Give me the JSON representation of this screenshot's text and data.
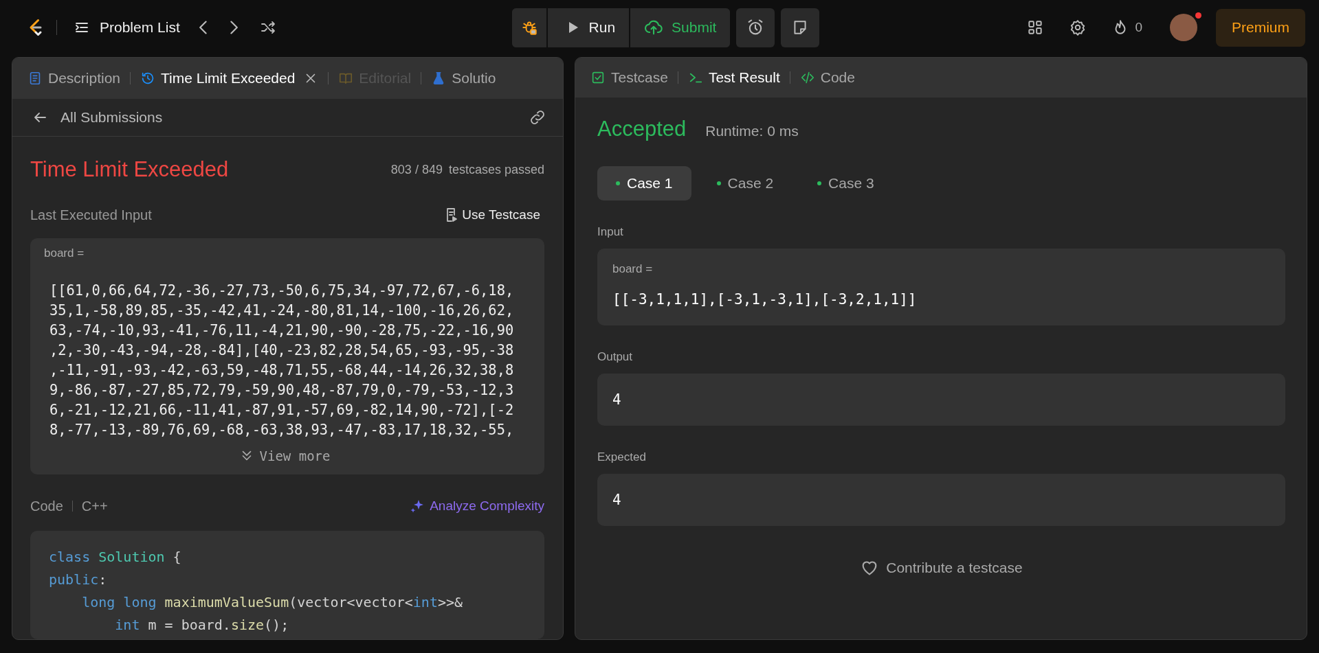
{
  "topbar": {
    "problem_list": "Problem List",
    "run": "Run",
    "submit": "Submit",
    "streak": "0",
    "premium": "Premium",
    "notification_dot": true
  },
  "left_panel": {
    "tabs": [
      {
        "label": "Description",
        "selected": false,
        "disabled": false,
        "closable": false
      },
      {
        "label": "Time Limit Exceeded",
        "selected": true,
        "disabled": false,
        "closable": true
      },
      {
        "label": "Editorial",
        "selected": false,
        "disabled": true,
        "closable": false
      },
      {
        "label": "Solutio",
        "selected": false,
        "disabled": false,
        "closable": false
      }
    ],
    "back_link": "All Submissions",
    "status": "Time Limit Exceeded",
    "accepted": false,
    "passed": "803 / 849",
    "passed_suffix": "testcases passed",
    "last_input_label": "Last Executed Input",
    "use_testcase": "Use Testcase",
    "input": {
      "name": "board =",
      "value_lines": [
        "[[61,0,66,64,72,-36,-27,73,-50,6,75,34,-97,72,67,-6,18,",
        "35,1,-58,89,85,-35,-42,41,-24,-80,81,14,-100,-16,26,62,",
        "63,-74,-10,93,-41,-76,11,-4,21,90,-90,-28,75,-22,-16,90",
        ",2,-30,-43,-94,-28,-84],[40,-23,82,28,54,65,-93,-95,-38",
        ",-11,-91,-93,-42,-63,59,-48,71,55,-68,44,-14,26,32,38,8",
        "9,-86,-87,-27,85,72,79,-59,90,48,-87,79,0,-79,-53,-12,3",
        "6,-21,-12,21,66,-11,41,-87,91,-57,69,-82,14,90,-72],[-2",
        "8,-77,-13,-89,76,69,-68,-63,38,93,-47,-83,17,18,32,-55,"
      ]
    },
    "view_more": "View more",
    "code_label": "Code",
    "language": "C++",
    "analyze": "Analyze Complexity",
    "code_lines": [
      [
        {
          "text": "class ",
          "kind": "keyword"
        },
        {
          "text": "Solution",
          "kind": "class"
        },
        {
          "text": " {",
          "kind": "plain"
        }
      ],
      [
        {
          "text": "public",
          "kind": "keyword"
        },
        {
          "text": ":",
          "kind": "plain"
        }
      ],
      [
        {
          "text": "    long long ",
          "kind": "keyword"
        },
        {
          "text": "maximumValueSum",
          "kind": "function"
        },
        {
          "text": "(vector<vector<",
          "kind": "plain"
        },
        {
          "text": "int",
          "kind": "keyword"
        },
        {
          "text": ">>& ",
          "kind": "plain"
        }
      ],
      [
        {
          "text": "        int",
          "kind": "keyword"
        },
        {
          "text": " m = board.",
          "kind": "plain"
        },
        {
          "text": "size",
          "kind": "function"
        },
        {
          "text": "();",
          "kind": "plain"
        }
      ]
    ]
  },
  "right_panel": {
    "tabs": [
      {
        "label": "Testcase",
        "selected": false
      },
      {
        "label": "Test Result",
        "selected": true
      },
      {
        "label": "Code",
        "selected": false
      }
    ],
    "verdict": "Accepted",
    "accepted": true,
    "runtime": "Runtime: 0 ms",
    "cases": [
      {
        "label": "Case 1",
        "selected": true,
        "color": "#2cbb5d"
      },
      {
        "label": "Case 2",
        "selected": false,
        "color": "#2cbb5d"
      },
      {
        "label": "Case 3",
        "selected": false,
        "color": "#2cbb5d"
      }
    ],
    "sections": [
      {
        "label": "Input",
        "kind": "param",
        "name": "board =",
        "value": "[[-3,1,1,1],[-3,1,-3,1],[-3,2,1,1]]"
      },
      {
        "label": "Output",
        "kind": "plain",
        "value": "4"
      },
      {
        "label": "Expected",
        "kind": "plain",
        "value": "4"
      }
    ],
    "contribute": "Contribute a testcase"
  }
}
